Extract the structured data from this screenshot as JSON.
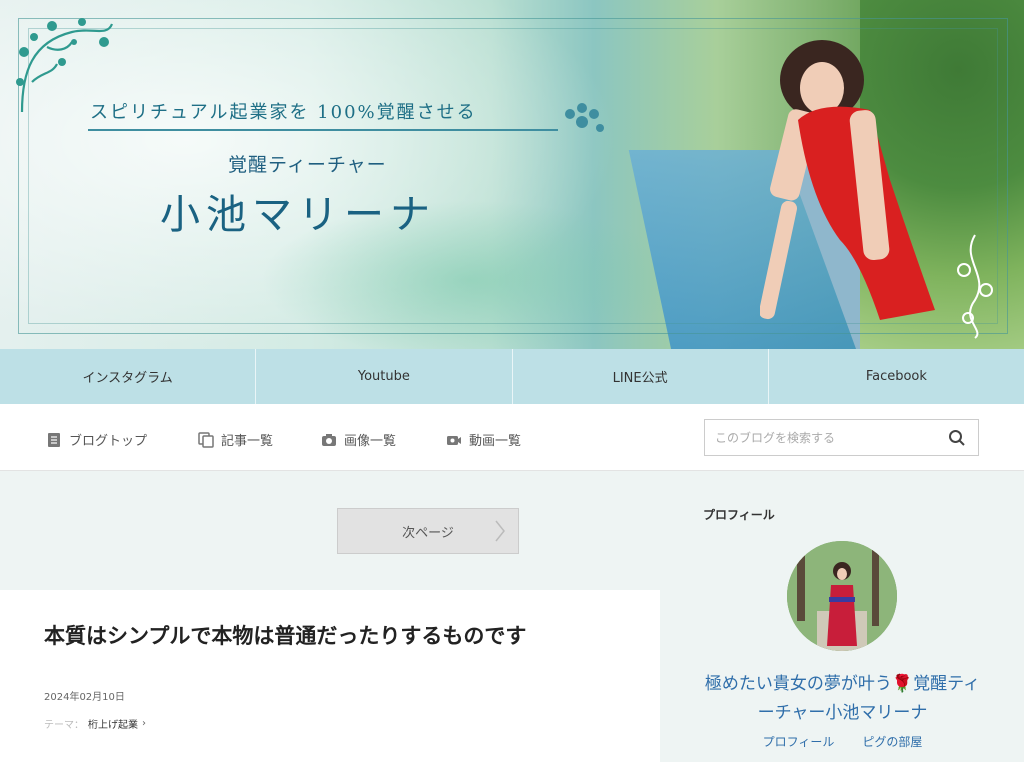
{
  "header": {
    "tagline": "スピリチュアル起業家を 100%覚醒させる",
    "subtitle": "覚醒ティーチャー",
    "name": "小池マリーナ"
  },
  "social_nav": [
    {
      "label": "インスタグラム"
    },
    {
      "label": "Youtube"
    },
    {
      "label": "LINE公式"
    },
    {
      "label": "Facebook"
    }
  ],
  "menu": {
    "items": [
      {
        "label": "ブログトップ",
        "icon": "document-icon"
      },
      {
        "label": "記事一覧",
        "icon": "copy-icon"
      },
      {
        "label": "画像一覧",
        "icon": "camera-icon"
      },
      {
        "label": "動画一覧",
        "icon": "video-icon"
      }
    ],
    "search_placeholder": "このブログを検索する"
  },
  "pagination": {
    "next_label": "次ページ"
  },
  "article": {
    "title": "本質はシンプルで本物は普通だったりするものです",
    "date": "2024年02月10日",
    "theme_prefix": "テーマ：",
    "theme": "桁上げ起業"
  },
  "sidebar": {
    "title": "プロフィール",
    "profile_name": "極めたい貴女の夢が叶う🌹覚醒ティーチャー小池マリーナ",
    "links": [
      "プロフィール",
      "ピグの部屋"
    ]
  },
  "colors": {
    "nav_bg": "#bde0e6",
    "link": "#2f6eaa",
    "header_text": "#1a6282"
  }
}
